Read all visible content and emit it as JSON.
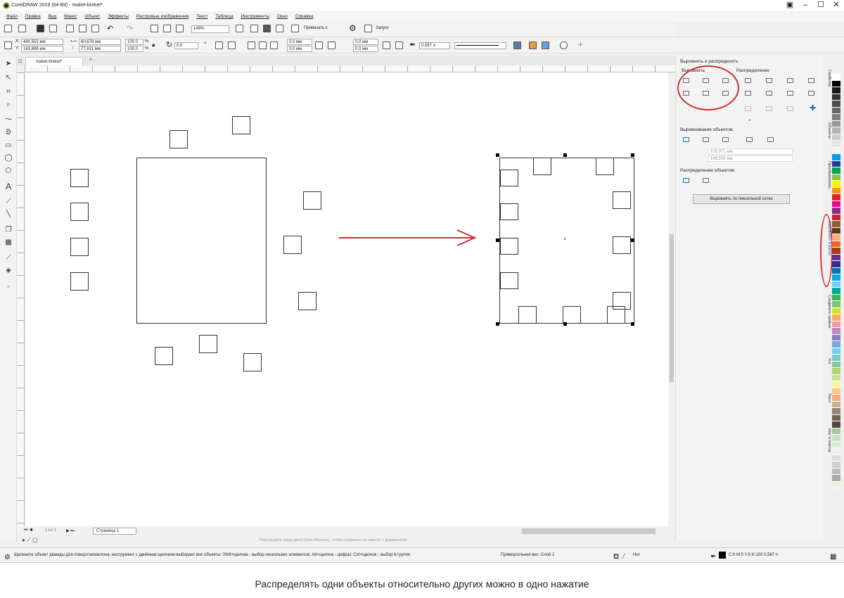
{
  "window": {
    "title": "CorelDRAW 2019 (64-Bit) - maket-breket*",
    "controls": [
      "▣",
      "–",
      "☐",
      "✕"
    ]
  },
  "menu": [
    "Файл",
    "Правка",
    "Вид",
    "Макет",
    "Объект",
    "Эффекты",
    "Растровые изображения",
    "Текст",
    "Таблица",
    "Инструменты",
    "Окно",
    "Справка"
  ],
  "toolbar": {
    "zoom": "146%",
    "snap_label": "Привязать к",
    "launch_label": "Запуск"
  },
  "propbar": {
    "x": "490,552 мм",
    "y": "163,888 мм",
    "w": "60,678 мм",
    "h": "77,611 мм",
    "sx": "100,0",
    "sy": "100,0",
    "pct": "%",
    "angle": "0,0",
    "corner1": "0,0 мм",
    "corner2": "0,0 мм",
    "corner3": "0,0 мм",
    "corner4": "0,0 мм",
    "outline": "0,567 п"
  },
  "document": {
    "tab": "maket-breket*",
    "page": "Страница 1",
    "page_count": "1 из 1"
  },
  "hint": "Перетащите сюда цвета (или объекты), чтобы сохранить их вместе с документом",
  "panel": {
    "title": "Выровнять и распределить",
    "align_label": "Выровнять",
    "distribute_label": "Распределение",
    "align_objects_label": "Выравнивание объектов:",
    "coord_x": "105,071 мм",
    "coord_y": "148,505 мм",
    "distribute_objects_label": "Распределение объектов:",
    "pixel_grid_button": "Выровнять по пиксельной сетке"
  },
  "side_tabs": [
    "Свойства",
    "Объекты",
    "Преобразовать",
    "Выровнять и распр.",
    "Соединить кривые",
    "Угл",
    "Текст",
    "Шаг и повтор"
  ],
  "status": {
    "help": "Щелкните объект дважды для поворота/наклона; инструмент с двойным щелчком выбирает все объекты; Shift+щелчок - выбор нескольких элементов; Alt+щелчок - цифры; Ctrl+щелчок - выбор в группе",
    "object_info": "Прямоугольник вкл. Слой 1",
    "fill": "Нет",
    "outline": "C:0 M:0 Y:0 K:100  0,567 п"
  },
  "caption": "Распределять одни объекты относительно других можно в одно нажатие",
  "colors": {
    "accent": "#d32f2f",
    "palette": [
      "#ffffff",
      "#000000",
      "#1a1a1a",
      "#333333",
      "#4d4d4d",
      "#666666",
      "#808080",
      "#999999",
      "#b3b3b3",
      "#cccccc",
      "#e6e6e6",
      "#f2f2f2",
      "#00a0e9",
      "#1e3f9c",
      "#00a651",
      "#8dc63f",
      "#fff200",
      "#f7941d",
      "#ed1c24",
      "#ec008c",
      "#92278f",
      "#c1272d",
      "#8b5e3c",
      "#603913",
      "#f9ad81",
      "#f26522",
      "#a0410d",
      "#662d91",
      "#2e3192",
      "#0072bc",
      "#00aeef",
      "#6dcff6",
      "#00a99d",
      "#39b54a",
      "#7cc576",
      "#d7e021",
      "#fbaf5d",
      "#f5989d",
      "#bd8cbf",
      "#8781bd",
      "#7da7d9",
      "#6ecff6",
      "#7accc8",
      "#82ca9c",
      "#acd373",
      "#c4df9b",
      "#fff799",
      "#fdc68a",
      "#f9ad81",
      "#c7b299",
      "#998675",
      "#736357",
      "#534741",
      "#a4c8a0",
      "#c8e0c4",
      "#d9ead3",
      "#eeeeee",
      "#dddddd",
      "#cfcfcf",
      "#bbbbbb",
      "#aaaaaa",
      "#eef3d8"
    ]
  }
}
